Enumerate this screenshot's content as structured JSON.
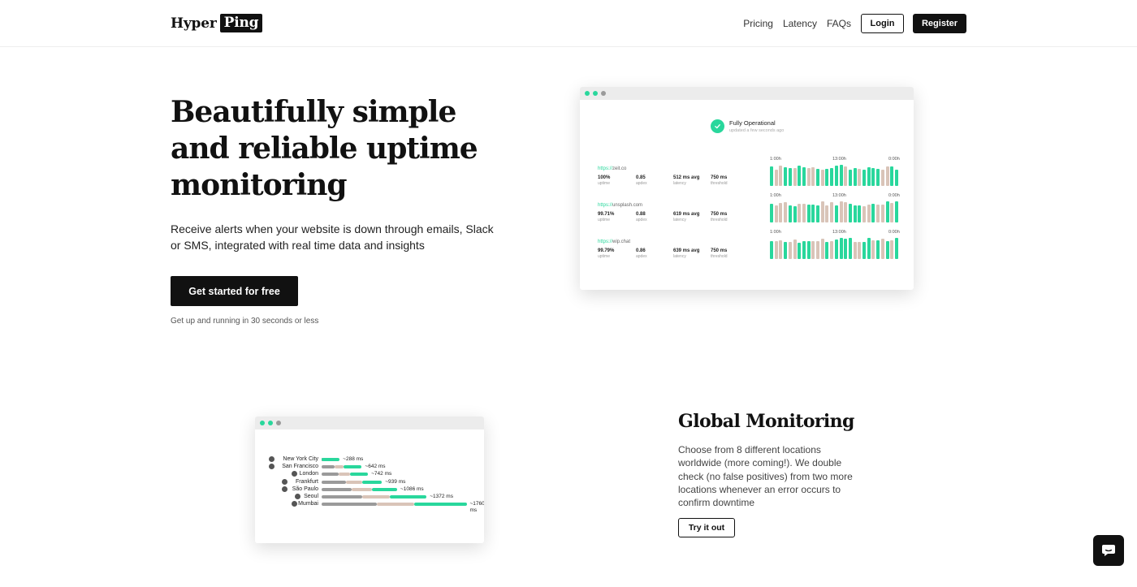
{
  "nav": {
    "logo_part1": "Hyper",
    "logo_part2": "Ping",
    "links": [
      "Pricing",
      "Latency",
      "FAQs"
    ],
    "login_label": "Login",
    "register_label": "Register"
  },
  "hero": {
    "title": "Beautifully simple and reliable uptime monitoring",
    "subtitle": "Receive alerts when your website is down through emails, Slack or SMS, integrated with real time data and insights",
    "cta_label": "Get started for free",
    "note": "Get up and running in 30 seconds or less"
  },
  "dashboard": {
    "status_title": "Fully Operational",
    "status_sub": "updated a few seconds ago",
    "time_ticks": [
      "1:00h",
      "13:00h",
      "0:00h"
    ],
    "monitors": [
      {
        "url_proto": "https://",
        "url_host": "zeit.co",
        "uptime": "100%",
        "uptime_label": "uptime",
        "apdex": "0.85",
        "apdex_label": "apdex",
        "latency": "512 ms avg",
        "latency_label": "latency",
        "threshold": "750 ms",
        "threshold_label": "threshold"
      },
      {
        "url_proto": "https://",
        "url_host": "unsplash.com",
        "uptime": "99.71%",
        "uptime_label": "uptime",
        "apdex": "0.88",
        "apdex_label": "apdex",
        "latency": "619 ms avg",
        "latency_label": "latency",
        "threshold": "750 ms",
        "threshold_label": "threshold"
      },
      {
        "url_proto": "https://",
        "url_host": "wip.chat",
        "uptime": "99.79%",
        "uptime_label": "uptime",
        "apdex": "0.86",
        "apdex_label": "apdex",
        "latency": "639 ms avg",
        "latency_label": "latency",
        "threshold": "750 ms",
        "threshold_label": "threshold"
      }
    ],
    "colors": {
      "ok": "#29d79c",
      "slow": "#d9c4b8"
    }
  },
  "latency_demo": {
    "locations": [
      {
        "name": "New York City",
        "ms": "~288 ms",
        "value": 288
      },
      {
        "name": "San Francisco",
        "ms": "~642 ms",
        "value": 642
      },
      {
        "name": "London",
        "ms": "~742 ms",
        "value": 742
      },
      {
        "name": "Frankfurt",
        "ms": "~939 ms",
        "value": 939
      },
      {
        "name": "São Paulo",
        "ms": "~1086 ms",
        "value": 1086
      },
      {
        "name": "Seoul",
        "ms": "~1372 ms",
        "value": 1372
      },
      {
        "name": "Mumbai",
        "ms": "~1760 ms",
        "value": 1760
      }
    ]
  },
  "global": {
    "title": "Global Monitoring",
    "text": "Choose from 8 different locations worldwide (more coming!). We double check (no false positives) from two more locations whenever an error occurs to confirm downtime",
    "cta_label": "Try it out"
  },
  "chat": {
    "icon": "chat-bubble-icon"
  }
}
